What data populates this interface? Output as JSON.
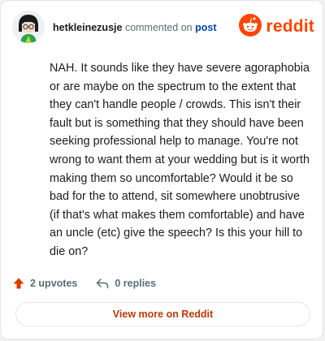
{
  "comment": {
    "username": "hetkleinezusje",
    "action_text": "commented on",
    "post_link": "post",
    "body": "NAH. It sounds like they have severe agoraphobia or are maybe on the spectrum to the extent that they can't handle people / crowds. This isn't their fault but is something that they should have been seeking professional help to manage. You're not wrong to want them at your wedding but is it worth making them so uncomfortable? Would it be so bad for the to attend, sit somewhere unobtrusive (if that's what makes them comfortable) and have an uncle (etc) give the speech? Is this your hill to die on?"
  },
  "brand": {
    "name": "reddit",
    "color": "#ff4500"
  },
  "actions": {
    "upvotes": "2 upvotes",
    "replies": "0 replies"
  },
  "footer": {
    "view_more": "View more on Reddit"
  },
  "icons": {
    "avatar": "avatar-icon",
    "logo": "reddit-snoo-icon",
    "upvote": "upvote-arrow-icon",
    "reply": "reply-arrow-icon"
  }
}
